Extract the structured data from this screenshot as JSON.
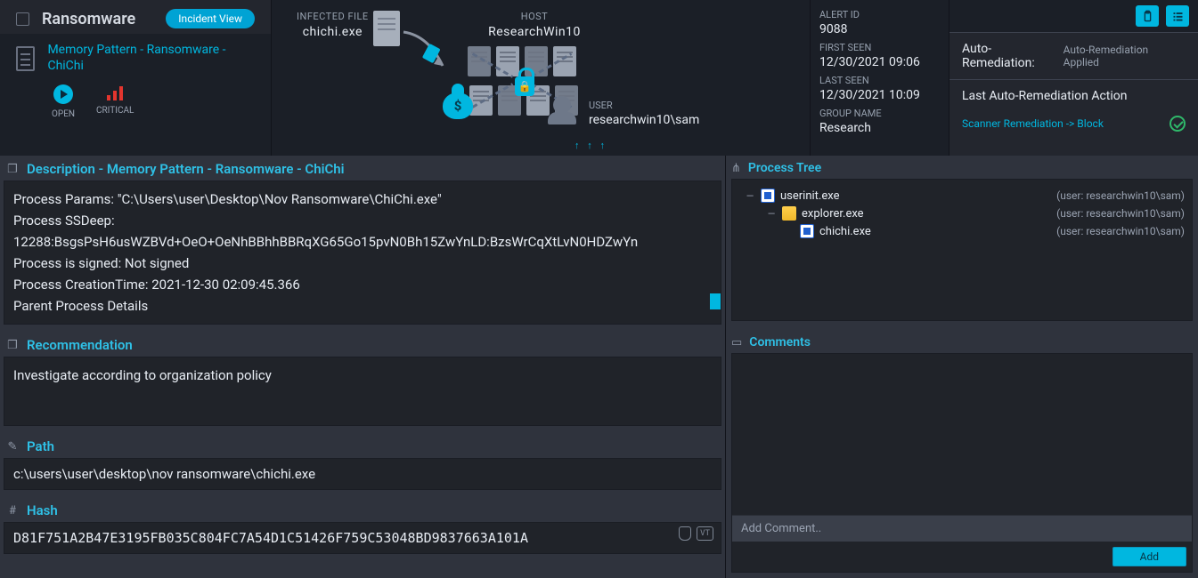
{
  "header": {
    "title": "Ransomware",
    "view_pill": "Incident View",
    "mem_link": "Memory Pattern - Ransomware - ChiChi",
    "open_label": "OPEN",
    "crit_label": "CRITICAL"
  },
  "graph": {
    "infected_label": "INFECTED FILE",
    "infected_file": "chichi.exe",
    "host_label": "HOST",
    "host_name": "ResearchWin10",
    "user_label": "USER",
    "user_name": "researchwin10\\sam",
    "arrows": "↑ ↑ ↑"
  },
  "meta": {
    "alert_id_l": "ALERT ID",
    "alert_id": "9088",
    "first_l": "FIRST SEEN",
    "first": "12/30/2021 09:06",
    "last_l": "LAST SEEN",
    "last": "12/30/2021 10:09",
    "group_l": "GROUP NAME",
    "group": "Research"
  },
  "remed": {
    "auto_k": "Auto-Remediation:",
    "auto_v": "Auto-Remediation Applied",
    "last_title": "Last Auto-Remediation Action",
    "link": "Scanner Remediation -> Block"
  },
  "desc": {
    "title": "Description - Memory Pattern - Ransomware - ChiChi",
    "l1": "Process Params: \"C:\\Users\\user\\Desktop\\Nov Ransomware\\ChiChi.exe\"",
    "l2": "Process SSDeep:",
    "l3": "12288:BsgsPsH6usWZBVd+OeO+OeNhBBhhBBRqXG65Go15pvN0Bh15ZwYnLD:BzsWrCqXtLvN0HDZwYn",
    "l4": "Process is signed: Not signed",
    "l5": "Process CreationTime: 2021-12-30 02:09:45.366",
    "l6": "Parent Process Details"
  },
  "reco": {
    "title": "Recommendation",
    "body": "Investigate according to organization policy"
  },
  "path": {
    "title": "Path",
    "body": "c:\\users\\user\\desktop\\nov ransomware\\chichi.exe"
  },
  "hash": {
    "title": "Hash",
    "body": "D81F751A2B47E3195FB035C804FC7A54D1C51426F759C53048BD9837663A101A",
    "vt": "VT"
  },
  "tree": {
    "title": "Process Tree",
    "n1": "userinit.exe",
    "u1": "(user: researchwin10\\sam)",
    "n2": "explorer.exe",
    "u2": "(user: researchwin10\\sam)",
    "n3": "chichi.exe",
    "u3": "(user: researchwin10\\sam)"
  },
  "comments": {
    "title": "Comments",
    "placeholder": "Add Comment..",
    "add": "Add"
  }
}
